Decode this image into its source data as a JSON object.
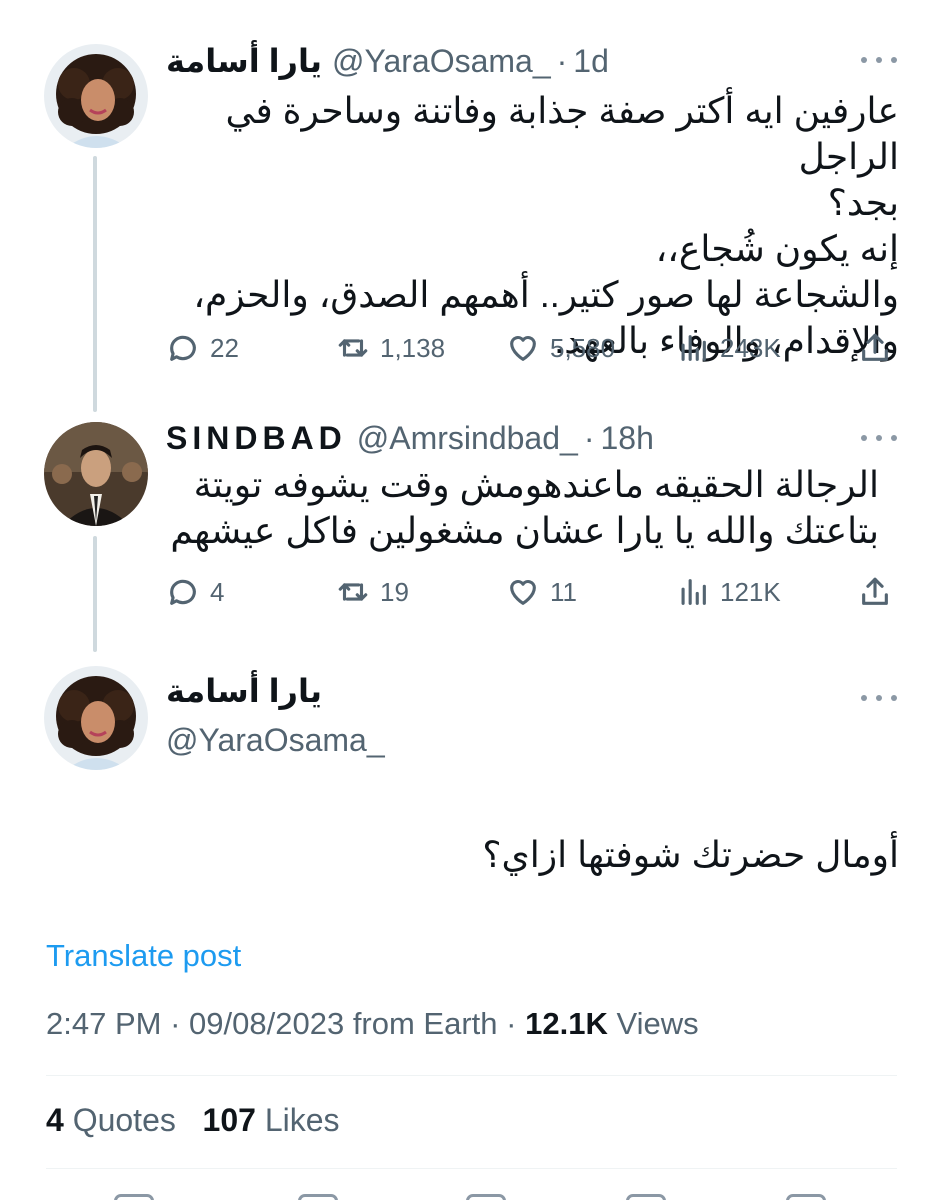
{
  "tweets": [
    {
      "name": "يارا أسامة",
      "handle": "@YaraOsama_",
      "time": "1d",
      "text": "عارفين ايه أكتر صفة جذابة وفاتنة وساحرة في الراجل\nبجد؟\nإنه يكون شُجاع،،\nوالشجاعة لها صور كتير.. أهمهم الصدق، والحزم،\nوالإقدام، والوفاء بالعهد.",
      "replies": "22",
      "retweets": "1,138",
      "likes": "5,580",
      "views": "243K"
    },
    {
      "name": "SINDBAD",
      "handle": "@Amrsindbad_",
      "time": "18h",
      "text": "الرجالة الحقيقه ماعندهومش وقت يشوفه تويتة\nبتاعتك والله يا يارا عشان مشغولين فاكل عيشهم",
      "replies": "4",
      "retweets": "19",
      "likes": "11",
      "views": "121K"
    }
  ],
  "main_tweet": {
    "name": "يارا أسامة",
    "handle": "@YaraOsama_",
    "text": "أومال حضرتك شوفتها ازاي؟",
    "translate_label": "Translate post",
    "time": "2:47 PM",
    "date": "09/08/2023",
    "source": "from Earth",
    "views_count": "12.1K",
    "views_label": "Views",
    "quotes_count": "4",
    "quotes_label": "Quotes",
    "likes_count": "107",
    "likes_label": "Likes"
  },
  "separators": {
    "dot": "·"
  },
  "icons": {
    "reply": "reply-icon",
    "retweet": "retweet-icon",
    "like": "heart-icon",
    "views": "views-icon",
    "share": "share-icon",
    "more": "more-dots-icon"
  },
  "colors": {
    "primary_text": "#0f1419",
    "secondary_text": "#536471",
    "link": "#1d9bf0",
    "thread_line": "#cfd9de",
    "divider": "#eff3f4"
  }
}
